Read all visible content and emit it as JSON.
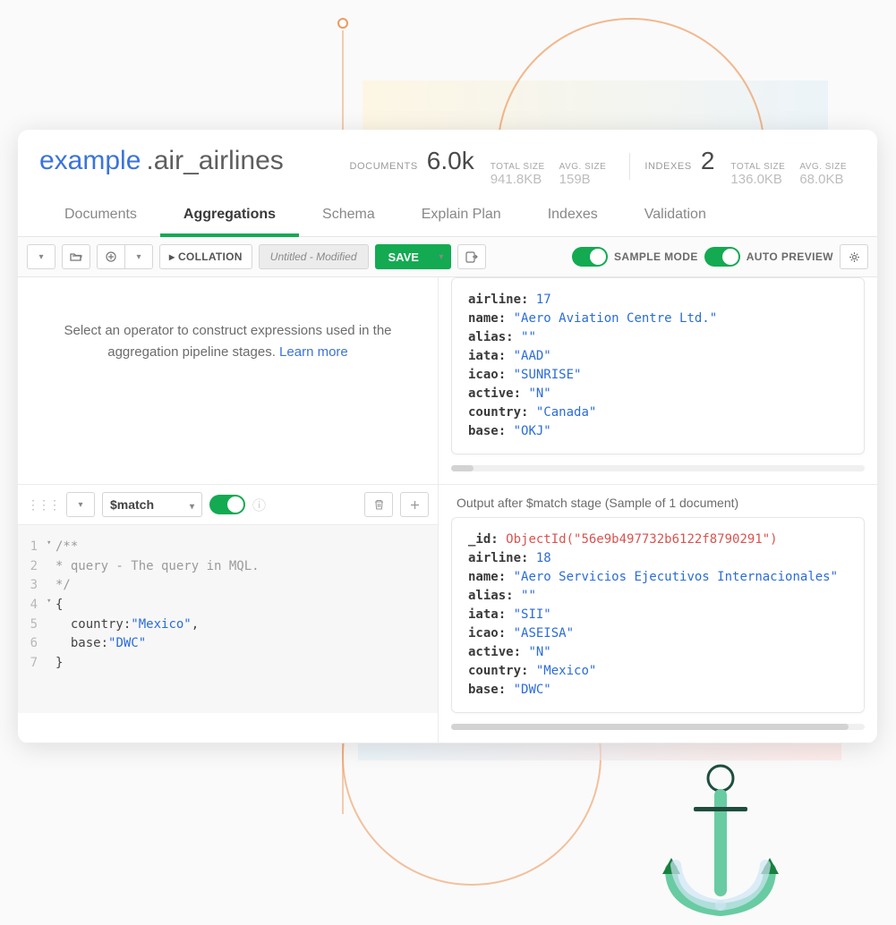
{
  "header": {
    "ns_prefix": "example",
    "ns_suffix": ".air_airlines",
    "documents_label": "DOCUMENTS",
    "documents_count": "6.0k",
    "docs_total_size_label": "TOTAL SIZE",
    "docs_total_size": "941.8KB",
    "docs_avg_size_label": "AVG. SIZE",
    "docs_avg_size": "159B",
    "indexes_label": "INDEXES",
    "indexes_count": "2",
    "idx_total_size_label": "TOTAL SIZE",
    "idx_total_size": "136.0KB",
    "idx_avg_size_label": "AVG. SIZE",
    "idx_avg_size": "68.0KB"
  },
  "tabs": {
    "documents": "Documents",
    "aggregations": "Aggregations",
    "schema": "Schema",
    "explain": "Explain Plan",
    "indexes": "Indexes",
    "validation": "Validation"
  },
  "toolbar": {
    "collation": "COLLATION",
    "collation_caret": "▸",
    "untitled": "Untitled - Modified",
    "save": "SAVE",
    "sample_mode": "SAMPLE MODE",
    "auto_preview": "AUTO PREVIEW"
  },
  "prompt": {
    "line1": "Select an operator to construct expressions used in the",
    "line2": "aggregation pipeline stages.",
    "learn": "Learn more"
  },
  "doc1": {
    "airline_k": "airline:",
    "airline_v": "17",
    "name_k": "name:",
    "name_v": "\"Aero Aviation Centre Ltd.\"",
    "alias_k": "alias:",
    "alias_v": "\"\"",
    "iata_k": "iata:",
    "iata_v": "\"AAD\"",
    "icao_k": "icao:",
    "icao_v": "\"SUNRISE\"",
    "active_k": "active:",
    "active_v": "\"N\"",
    "country_k": "country:",
    "country_v": "\"Canada\"",
    "base_k": "base:",
    "base_v": "\"OKJ\""
  },
  "stage": {
    "operator": "$match",
    "output_header": "Output after $match stage (Sample of 1 document)",
    "editor": {
      "l1": "/**",
      "l2": " * query - The query in MQL.",
      "l3": " */",
      "l4": "{",
      "l5_key": "country:",
      "l5_val": "\"Mexico\"",
      "l6_key": "base:",
      "l6_val": "\"DWC\"",
      "l7": "}"
    }
  },
  "doc2": {
    "id_k": "_id:",
    "id_v": "ObjectId(\"56e9b497732b6122f8790291\")",
    "airline_k": "airline:",
    "airline_v": "18",
    "name_k": "name:",
    "name_v": "\"Aero Servicios Ejecutivos Internacionales\"",
    "alias_k": "alias:",
    "alias_v": "\"\"",
    "iata_k": "iata:",
    "iata_v": "\"SII\"",
    "icao_k": "icao:",
    "icao_v": "\"ASEISA\"",
    "active_k": "active:",
    "active_v": "\"N\"",
    "country_k": "country:",
    "country_v": "\"Mexico\"",
    "base_k": "base:",
    "base_v": "\"DWC\""
  }
}
